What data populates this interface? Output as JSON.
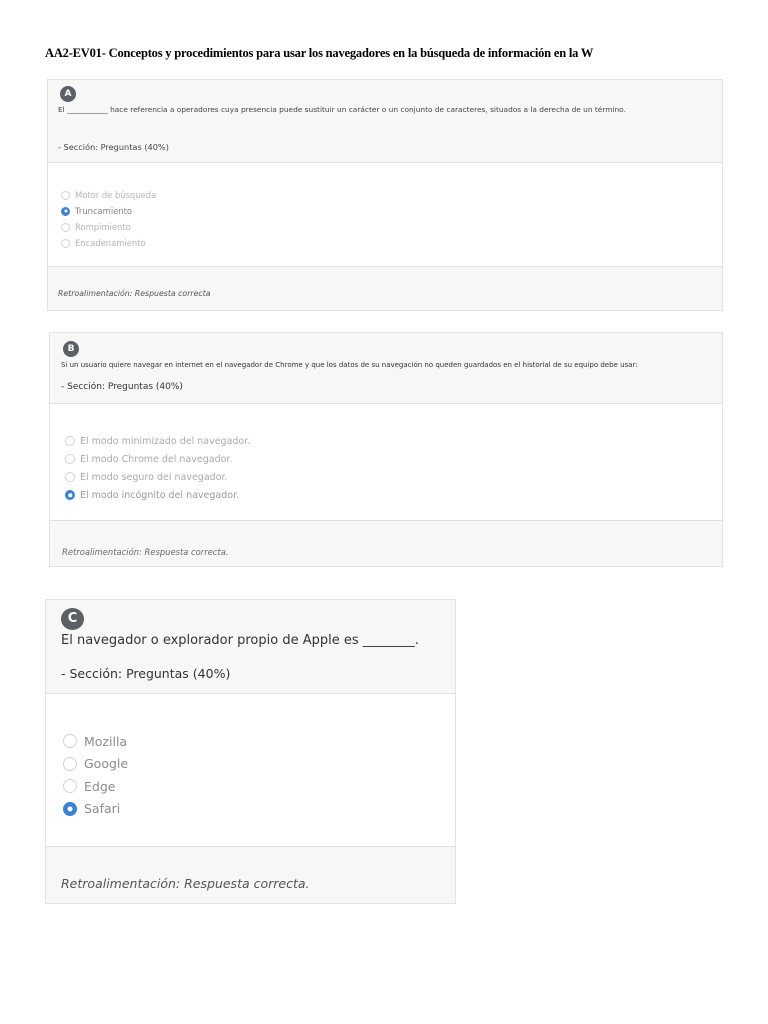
{
  "document": {
    "title": "AA2-EV01- Conceptos y procedimientos para usar los navegadores en la búsqueda de información en la W"
  },
  "questions": [
    {
      "badge": "A",
      "text": "El ___________ hace referencia a operadores cuya presencia puede sustituir un carácter o un conjunto de caracteres, situados a la derecha de un término.",
      "section": "- Sección: Preguntas (40%)",
      "options": [
        {
          "label": "Motor de búsqueda",
          "selected": false
        },
        {
          "label": "Truncamiento",
          "selected": true
        },
        {
          "label": "Rompimiento",
          "selected": false
        },
        {
          "label": "Encadenamiento",
          "selected": false
        }
      ],
      "feedback": "Retroalimentación: Respuesta correcta"
    },
    {
      "badge": "B",
      "text": "Si un usuario quiere navegar en internet en el navegador de Chrome y que los datos de su navegación no queden guardados en el historial de su equipo debe usar:",
      "section": "- Sección: Preguntas (40%)",
      "options": [
        {
          "label": "El modo minimizado del navegador.",
          "selected": false
        },
        {
          "label": "El modo Chrome del navegador.",
          "selected": false
        },
        {
          "label": "El modo seguro del navegador.",
          "selected": false
        },
        {
          "label": "El modo incógnito del navegador.",
          "selected": true
        }
      ],
      "feedback": "Retroalimentación: Respuesta correcta."
    },
    {
      "badge": "C",
      "text": "El navegador o explorador propio de Apple es ________.",
      "section": "- Sección: Preguntas (40%)",
      "options": [
        {
          "label": "Mozilla",
          "selected": false
        },
        {
          "label": "Google",
          "selected": false
        },
        {
          "label": "Edge",
          "selected": false
        },
        {
          "label": "Safari",
          "selected": true
        }
      ],
      "feedback": "Retroalimentación: Respuesta correcta."
    }
  ],
  "colors": {
    "badge": "#5b6067",
    "radio_selected": "#3b82d6",
    "card_header": "#f7f7f7"
  },
  "icons": {
    "radio_selected": "radio-checked-icon",
    "radio_unselected": "radio-unchecked-icon"
  }
}
